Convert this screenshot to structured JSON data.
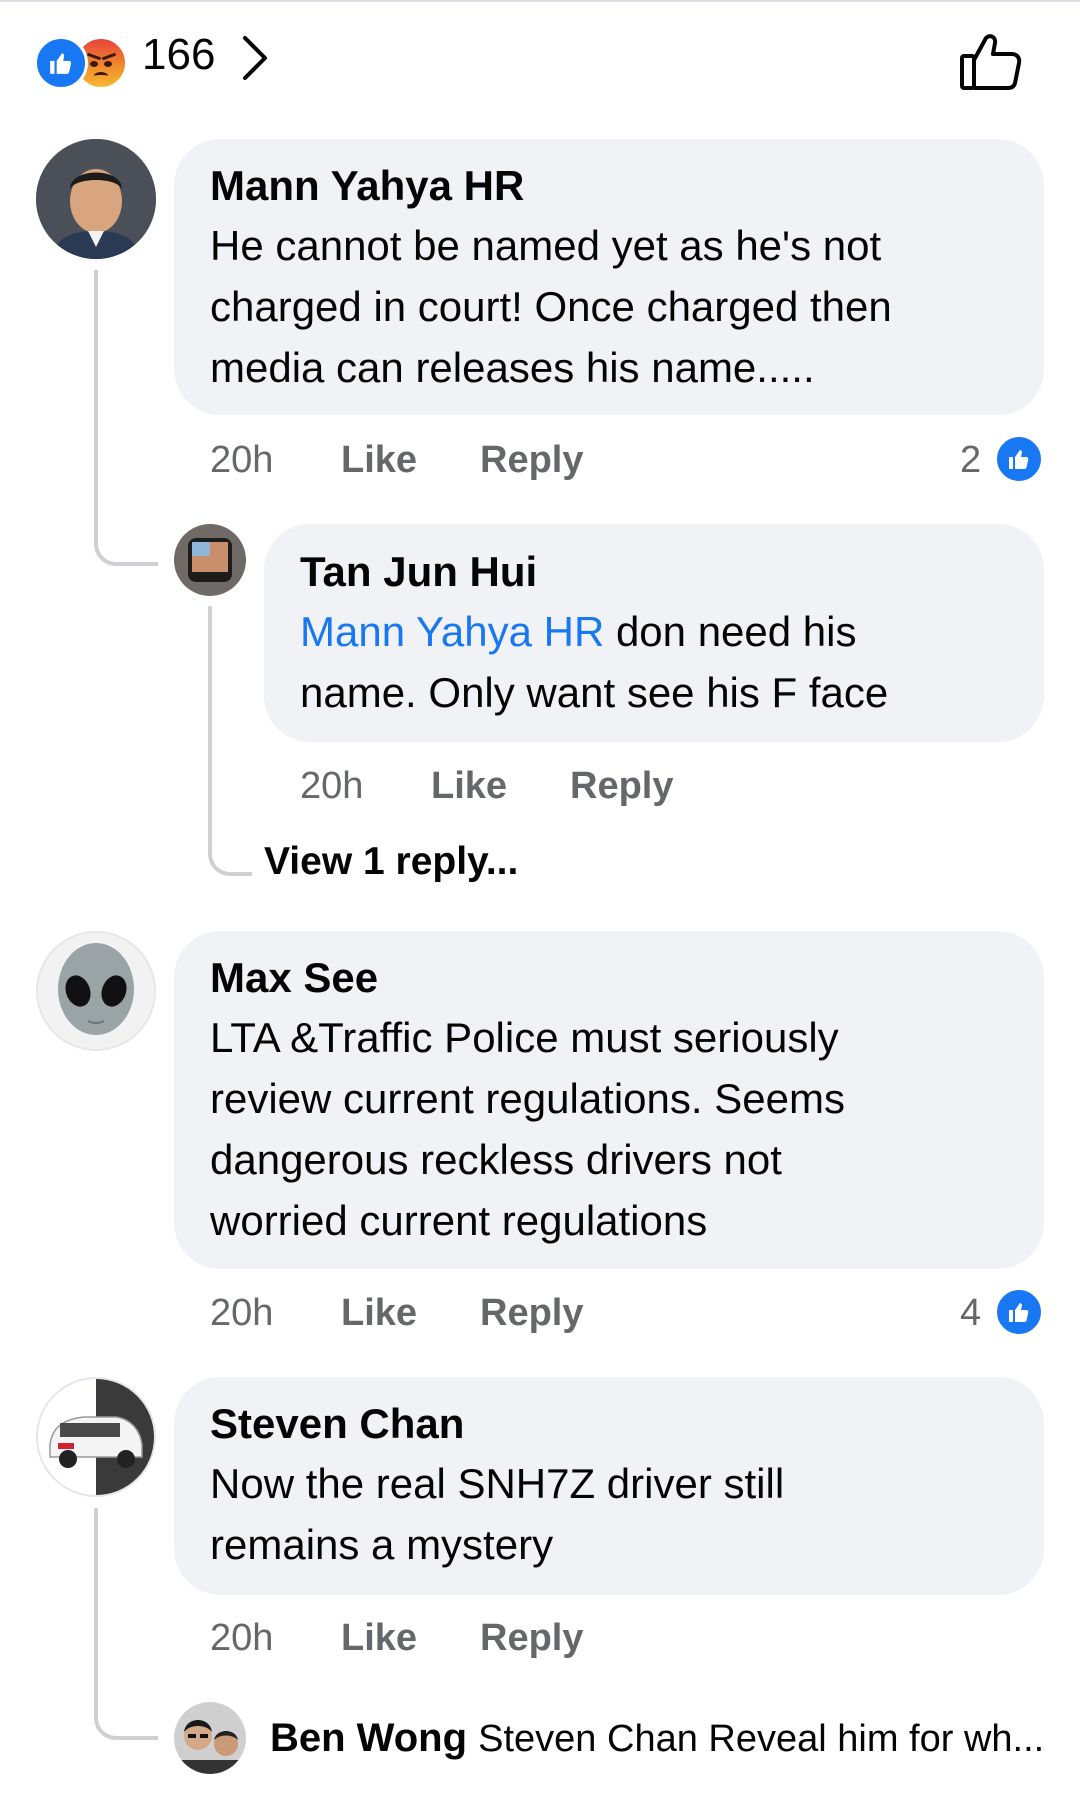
{
  "reactions": {
    "count": "166",
    "types": [
      "like-icon",
      "angry-icon"
    ],
    "like_color": "#1877f2"
  },
  "comments": [
    {
      "author": "Mann Yahya HR",
      "lines": [
        "He cannot be named yet as he's not",
        "charged in court! Once charged then",
        "media can releases his name....."
      ],
      "time": "20h",
      "like_label": "Like",
      "reply_label": "Reply",
      "likes": "2"
    },
    {
      "author": "Tan Jun Hui",
      "mention": "Mann Yahya HR",
      "line1_rest": " don need his",
      "line2": "name. Only want see his F face",
      "time": "20h",
      "like_label": "Like",
      "reply_label": "Reply",
      "view_replies": "View 1 reply..."
    },
    {
      "author": "Max See",
      "lines": [
        "LTA &Traffic Police must seriously",
        "review current regulations. Seems",
        "dangerous reckless drivers not",
        "worried current regulations"
      ],
      "time": "20h",
      "like_label": "Like",
      "reply_label": "Reply",
      "likes": "4"
    },
    {
      "author": "Steven Chan",
      "lines": [
        "Now the real SNH7Z driver still",
        "remains a mystery"
      ],
      "time": "20h",
      "like_label": "Like",
      "reply_label": "Reply"
    }
  ],
  "collapsed_reply": {
    "author": "Ben Wong",
    "preview": "Steven Chan Reveal him for wh..."
  },
  "colors": {
    "bubble": "#f0f2f5",
    "secondary_text": "#65676b",
    "mention": "#1877f2"
  }
}
